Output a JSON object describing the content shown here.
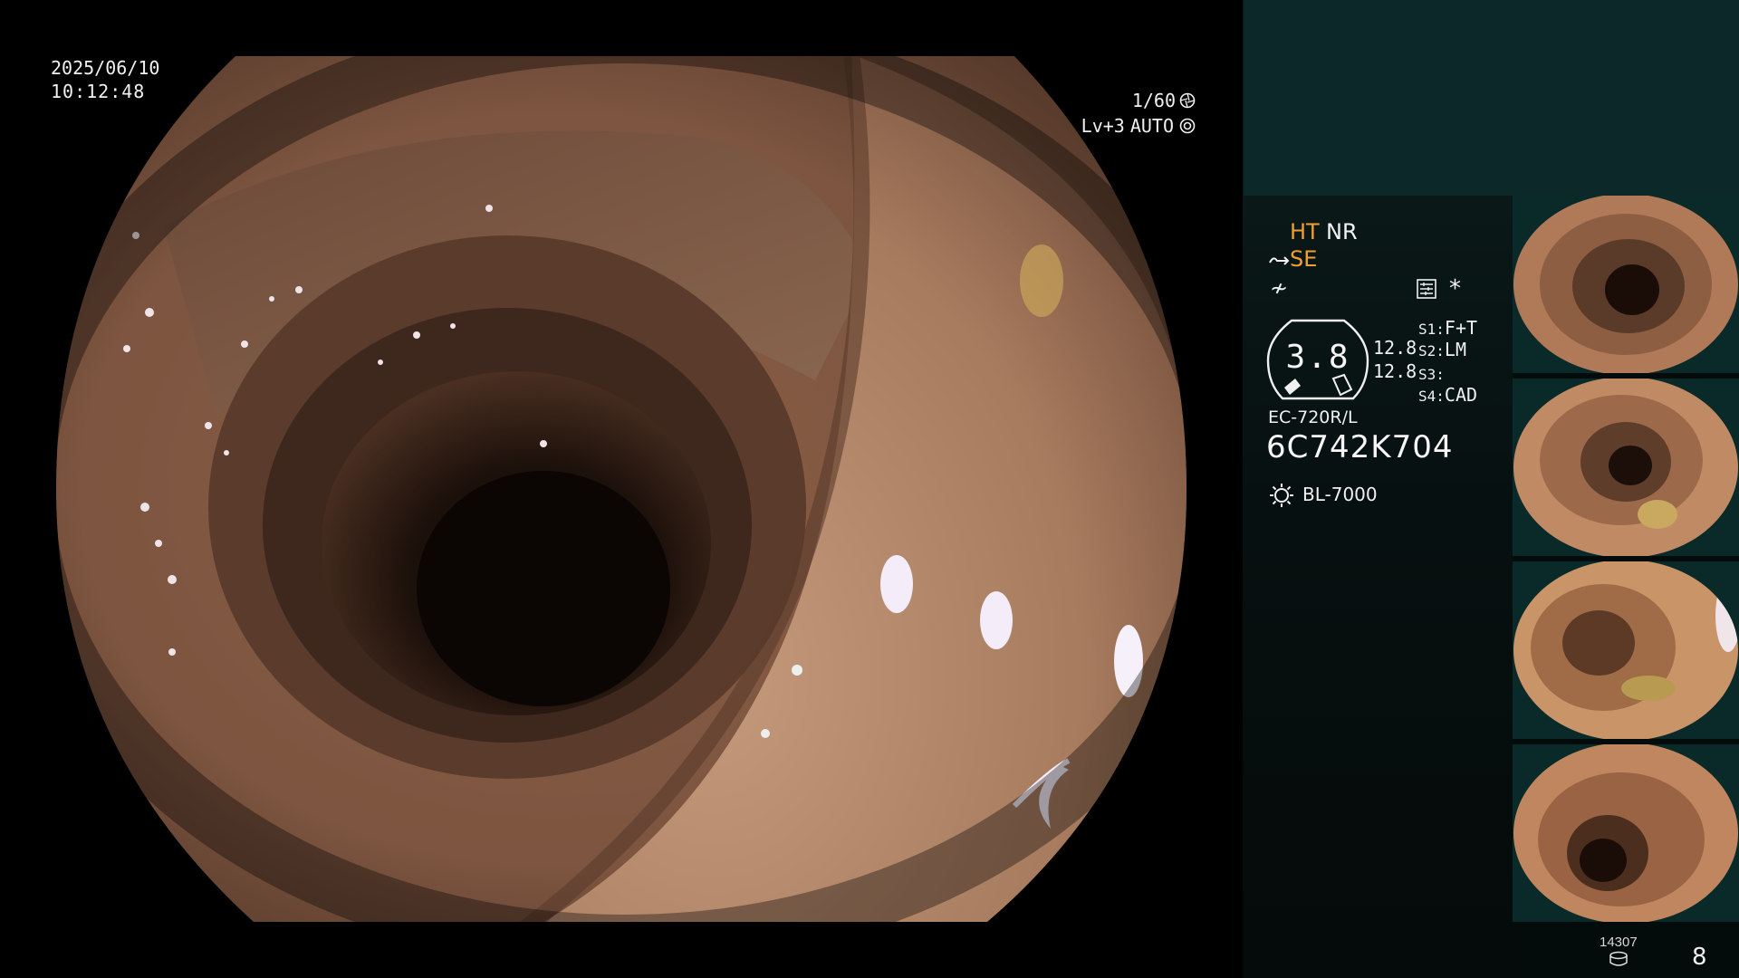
{
  "overlay": {
    "date": "2025/06/10",
    "time": "10:12:48",
    "shutter": "1/60",
    "level": "Lv+3",
    "mode": "AUTO"
  },
  "settings": {
    "ht": "HT",
    "nr": "NR",
    "se": "SE",
    "f_symbol": "≁",
    "asterisk": "*"
  },
  "gauge": {
    "value": "3.8",
    "num1": "12.8",
    "num2": "12.8"
  },
  "switches": [
    {
      "key": "S1:",
      "value": "F+T"
    },
    {
      "key": "S2:",
      "value": "LM"
    },
    {
      "key": "S3:",
      "value": ""
    },
    {
      "key": "S4:",
      "value": "CAD"
    }
  ],
  "scope": {
    "model": "EC-720R/L",
    "serial": "6C742K704",
    "light_source": "BL-7000"
  },
  "footer": {
    "counter_small": "14307",
    "counter_big": "8"
  },
  "colors": {
    "accent_orange": "#f0a030",
    "panel_teal": "#0c2828",
    "thumb_bg": "#0a2a2a"
  },
  "icons": [
    "aperture-icon",
    "iris-icon",
    "se-arrow-icon",
    "scale-icon",
    "gauge-icon",
    "light-bulb-icon",
    "disk-icon"
  ]
}
